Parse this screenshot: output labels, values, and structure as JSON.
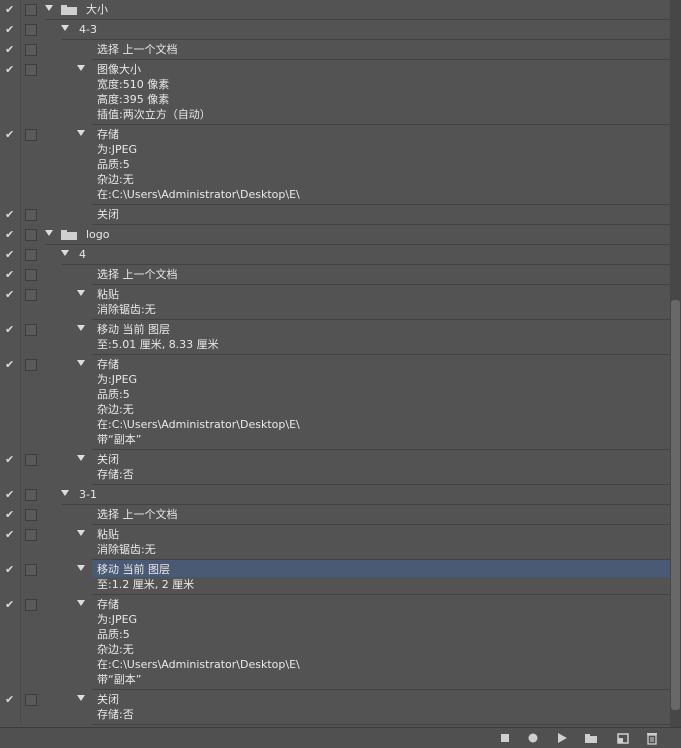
{
  "rows": [
    {
      "level": 0,
      "enabled": true,
      "label": "大小",
      "folder": true,
      "details": []
    },
    {
      "level": 1,
      "enabled": true,
      "label": "4-3",
      "details": []
    },
    {
      "level": 2,
      "enabled": true,
      "label": "选择 上一个文档",
      "expandable": false,
      "details": []
    },
    {
      "level": 2,
      "enabled": true,
      "label": "图像大小",
      "details": [
        "宽度:510 像素",
        "高度:395 像素",
        "插值:两次立方（自动）"
      ]
    },
    {
      "level": 2,
      "enabled": true,
      "label": "存储",
      "details": [
        "为:JPEG",
        "品质:5",
        "杂边:无",
        "在:C:\\Users\\Administrator\\Desktop\\E\\"
      ]
    },
    {
      "level": 2,
      "enabled": true,
      "label": "关闭",
      "expandable": false,
      "details": []
    },
    {
      "level": 0,
      "enabled": true,
      "label": "logo",
      "folder": true,
      "details": []
    },
    {
      "level": 1,
      "enabled": true,
      "label": "4",
      "details": []
    },
    {
      "level": 2,
      "enabled": true,
      "label": "选择 上一个文档",
      "expandable": false,
      "details": []
    },
    {
      "level": 2,
      "enabled": true,
      "label": "粘贴",
      "details": [
        "消除锯齿:无"
      ]
    },
    {
      "level": 2,
      "enabled": true,
      "label": "移动 当前 图层",
      "details": [
        "至:5.01 厘米, 8.33 厘米"
      ]
    },
    {
      "level": 2,
      "enabled": true,
      "label": "存储",
      "details": [
        "为:JPEG",
        "品质:5",
        "杂边:无",
        "在:C:\\Users\\Administrator\\Desktop\\E\\",
        "带“副本”"
      ]
    },
    {
      "level": 2,
      "enabled": true,
      "label": "关闭",
      "details": [
        "存储:否"
      ]
    },
    {
      "level": 1,
      "enabled": true,
      "label": "3-1",
      "details": []
    },
    {
      "level": 2,
      "enabled": true,
      "label": "选择 上一个文档",
      "expandable": false,
      "details": []
    },
    {
      "level": 2,
      "enabled": true,
      "label": "粘贴",
      "details": [
        "消除锯齿:无"
      ]
    },
    {
      "level": 2,
      "enabled": true,
      "label": "移动 当前 图层",
      "selected": true,
      "details": [
        "至:1.2 厘米, 2 厘米"
      ]
    },
    {
      "level": 2,
      "enabled": true,
      "label": "存储",
      "details": [
        "为:JPEG",
        "品质:5",
        "杂边:无",
        "在:C:\\Users\\Administrator\\Desktop\\E\\",
        "带“副本”"
      ]
    },
    {
      "level": 2,
      "enabled": true,
      "label": "关闭",
      "details": [
        "存储:否"
      ]
    }
  ],
  "toolbar": [
    {
      "name": "stop-recording-button",
      "icon": "stop-icon"
    },
    {
      "name": "record-button",
      "icon": "record-icon"
    },
    {
      "name": "play-button",
      "icon": "play-icon"
    },
    {
      "name": "new-set-button",
      "icon": "folder-icon"
    },
    {
      "name": "new-action-button",
      "icon": "new-item-icon"
    },
    {
      "name": "delete-button",
      "icon": "trash-icon"
    }
  ],
  "colors": {
    "selection": "#4b5a74",
    "panel": "#535353"
  }
}
